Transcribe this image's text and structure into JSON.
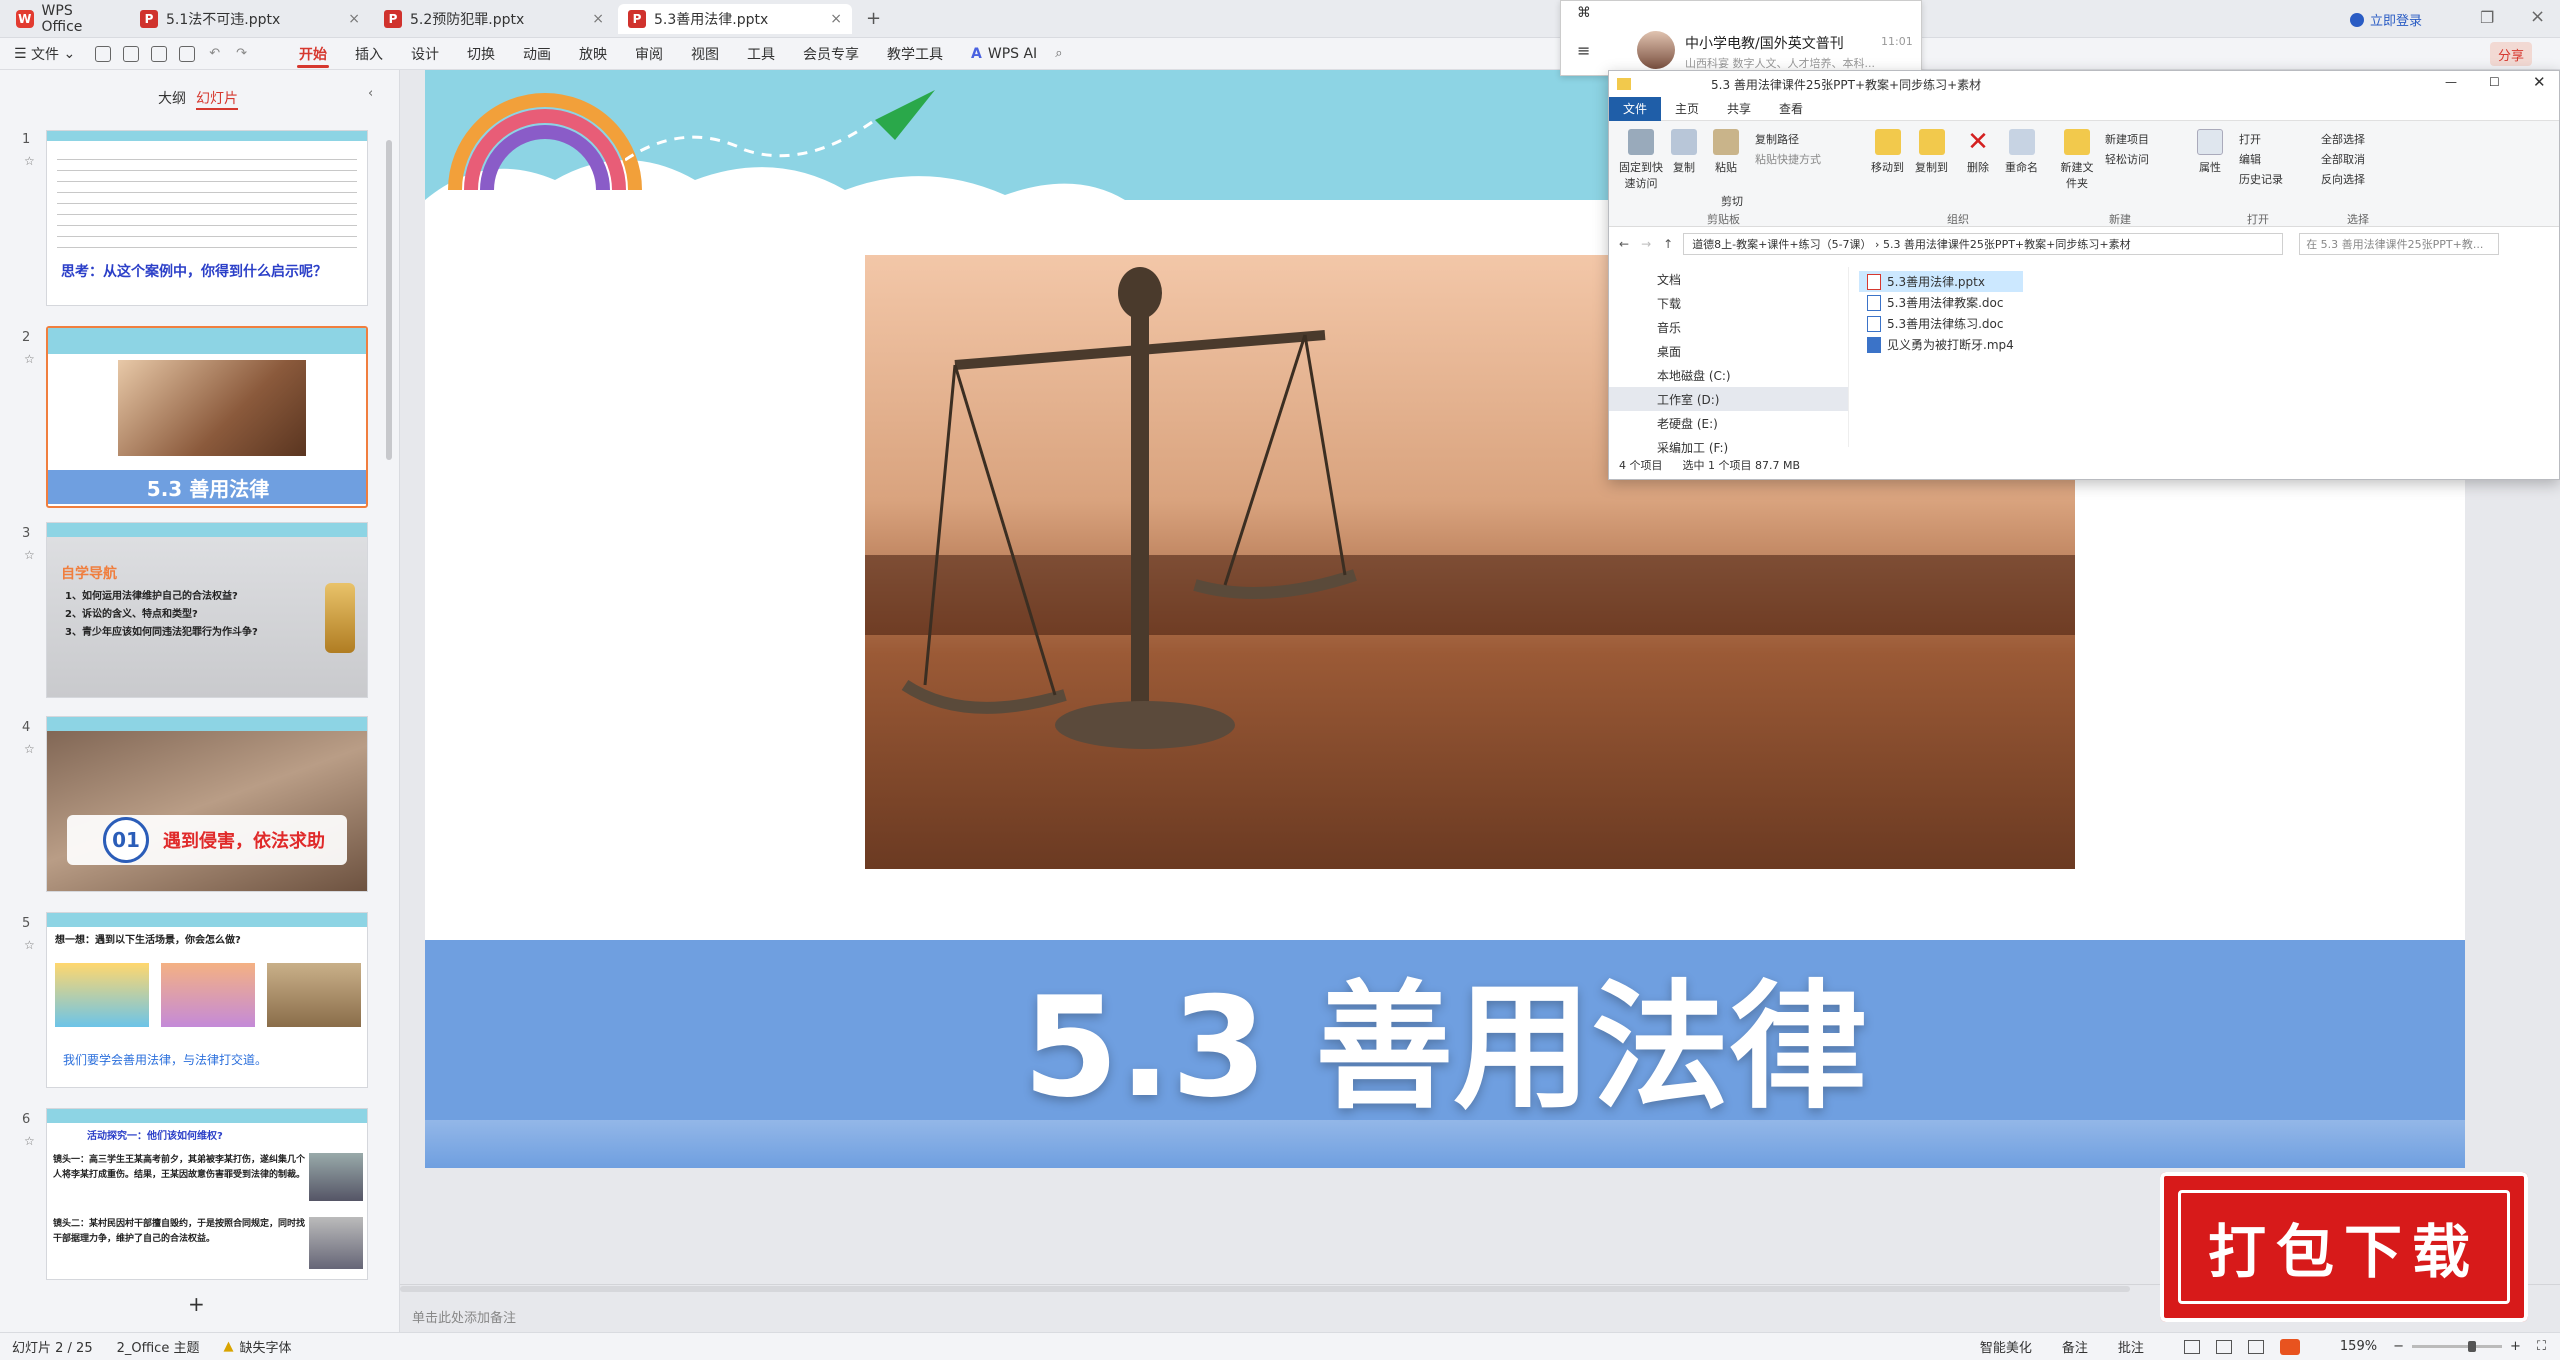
{
  "app": {
    "title": "WPS Office"
  },
  "tabs": [
    {
      "label": "5.1法不可违.pptx"
    },
    {
      "label": "5.2预防犯罪.pptx"
    },
    {
      "label": "5.3善用法律.pptx"
    }
  ],
  "titlebar_right": {
    "login": "立即登录"
  },
  "menu": {
    "file": "文件",
    "items": [
      "开始",
      "插入",
      "设计",
      "切换",
      "动画",
      "放映",
      "审阅",
      "视图",
      "工具",
      "会员专享",
      "教学工具"
    ],
    "ai": "WPS AI",
    "share": "分享"
  },
  "panel": {
    "tab_outline": "大纲",
    "tab_slides": "幻灯片"
  },
  "slides": [
    {
      "num": "1",
      "text": "思考：从这个案例中，你得到什么启示呢？"
    },
    {
      "num": "2",
      "text": "5.3 善用法律"
    },
    {
      "num": "3",
      "heading": "自学导航",
      "lines": [
        "1、如何运用法律维护自己的合法权益?",
        "2、诉讼的含义、特点和类型?",
        "3、青少年应该如何同违法犯罪行为作斗争?"
      ]
    },
    {
      "num": "4",
      "badge": "01",
      "text": "遇到侵害，依法求助"
    },
    {
      "num": "5",
      "heading": "想一想：遇到以下生活场景，你会怎么做?",
      "text": "我们要学会善用法律，与法律打交道。"
    },
    {
      "num": "6",
      "heading": "活动探究一：他们该如何维权?",
      "lines": [
        "镜头一：高三学生王某高考前夕，其弟被李某打伤，遂纠集几个人将李某打成重伤。结果，王某因故意伤害罪受到法律的制裁。",
        "镜头二：某村民因村干部擅自毁约，于是按照合同规定，同时找干部据理力争，维护了自己的合法权益。"
      ]
    }
  ],
  "main_slide": {
    "title": "5.3 善用法律"
  },
  "notes_placeholder": "单击此处添加备注",
  "watermark": "打包下载",
  "wechat": {
    "name": "中小学电教/国外英文普刊",
    "time": "11:01",
    "preview": "山西科宴 数字人文、人才培养、本科..."
  },
  "explorer": {
    "title": "5.3 善用法律课件25张PPT+教案+同步练习+素材",
    "ribbon_tabs": [
      "文件",
      "主页",
      "共享",
      "查看"
    ],
    "groups": {
      "clipboard": {
        "label": "剪贴板",
        "pin": "固定到快速访问",
        "copy": "复制",
        "paste": "粘贴",
        "copy_path": "复制路径",
        "paste_shortcut": "粘贴快捷方式",
        "cut": "剪切"
      },
      "organize": {
        "label": "组织",
        "move_to": "移动到",
        "copy_to": "复制到",
        "delete": "删除",
        "rename": "重命名"
      },
      "new": {
        "label": "新建",
        "new_folder": "新建文件夹",
        "new_item": "新建项目",
        "easy_access": "轻松访问"
      },
      "open": {
        "label": "打开",
        "properties": "属性",
        "open": "打开",
        "edit": "编辑",
        "history": "历史记录"
      },
      "select": {
        "label": "选择",
        "select_all": "全部选择",
        "select_none": "全部取消",
        "invert": "反向选择"
      }
    },
    "breadcrumb": "道德8上-教案+课件+练习（5-7课） ›  5.3  善用法律课件25张PPT+教案+同步练习+素材",
    "search_placeholder": "在 5.3 善用法律课件25张PPT+教...",
    "nav": [
      "文档",
      "下载",
      "音乐",
      "桌面",
      "本地磁盘 (C:)",
      "工作室 (D:)",
      "老硬盘 (E:)",
      "采编加工 (F:)"
    ],
    "files": [
      "5.3善用法律.pptx",
      "5.3善用法律教案.doc",
      "5.3善用法律练习.doc",
      "见义勇为被打断牙.mp4"
    ],
    "status": {
      "count": "4 个项目",
      "selected": "选中 1 个项目  87.7 MB"
    }
  },
  "status": {
    "slide": "幻灯片 2 / 25",
    "theme": "2_Office 主题",
    "font_missing": "缺失字体",
    "beautify": "智能美化",
    "notes": "备注",
    "comment": "批注",
    "zoom": "159%"
  },
  "colors": {
    "accent": "#d6382f",
    "banner": "#6f9fe0",
    "sky": "#8dd4e4",
    "thumb_orange": "#f07e3e"
  }
}
